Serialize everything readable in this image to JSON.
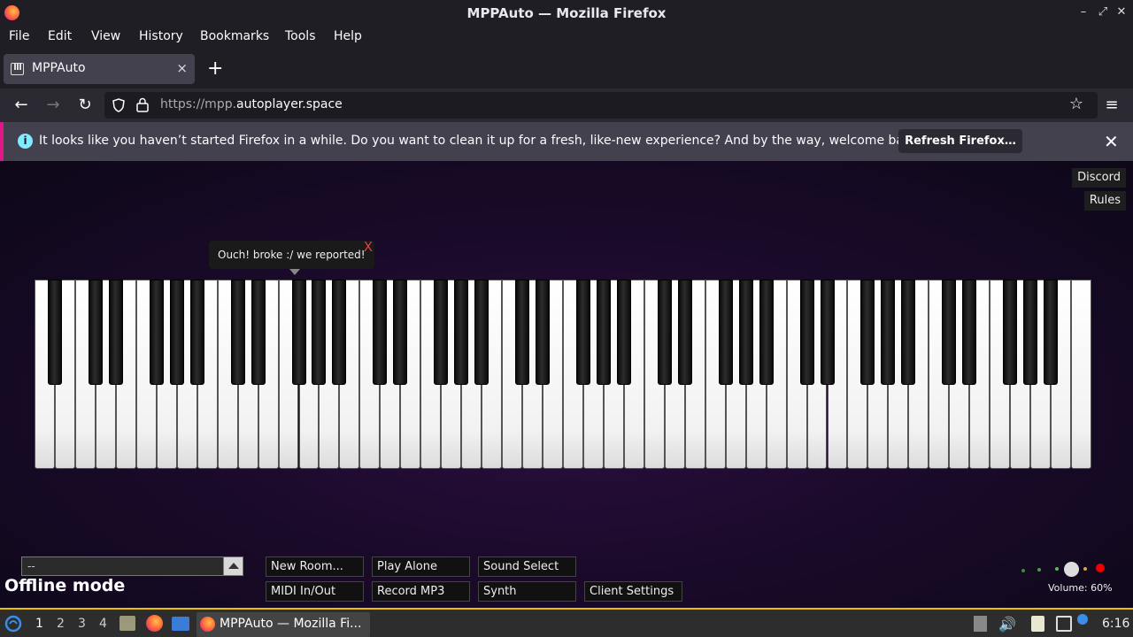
{
  "window": {
    "title": "MPPAuto — Mozilla Firefox"
  },
  "menu": [
    "File",
    "Edit",
    "View",
    "History",
    "Bookmarks",
    "Tools",
    "Help"
  ],
  "tab": {
    "label": "MPPAuto",
    "close": "×",
    "new": "+"
  },
  "nav": {
    "url_prefix": "https://mpp.",
    "url_host": "autoplayer.space"
  },
  "notification": {
    "message": "It looks like you haven’t started Firefox in a while. Do you want to clean it up for a fresh, like-new experience? And by the way, welcome back!",
    "button": "Refresh Firefox…",
    "info_glyph": "i",
    "close_glyph": "✕"
  },
  "page": {
    "side_buttons": [
      "Discord",
      "Rules"
    ],
    "tooltip": {
      "text": "Ouch! broke :/ we reported!",
      "close": "X"
    },
    "room_select": "--",
    "offline": "Offline mode",
    "buttons_row1": [
      "New Room...",
      "Play Alone",
      "Sound Select"
    ],
    "buttons_row2": [
      "MIDI In/Out",
      "Record MP3",
      "Synth",
      "Client Settings"
    ],
    "volume_label": "Volume: 60%",
    "volume_value": 60
  },
  "taskbar": {
    "desktops": [
      "1",
      "2",
      "3",
      "4"
    ],
    "app_label": "MPPAuto — Mozilla Fi...",
    "clock": "6:16"
  },
  "colors": {
    "accent": "#e31587",
    "info": "#80ebff",
    "taskbar_border": "#e8c000"
  }
}
